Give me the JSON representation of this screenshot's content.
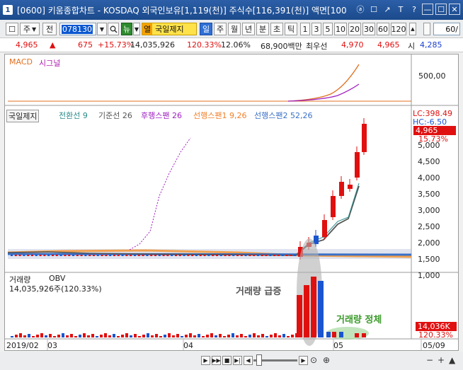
{
  "window": {
    "title": "[0600] 키움종합차트 - KOSDAQ 외국인보유[1,119(천)] 주식수[116,391(천)] 액면[100",
    "icon_label": "1",
    "controls": [
      "ⓐ",
      "☐",
      "↗",
      "T",
      "?",
      "—",
      "☐",
      "✕"
    ]
  },
  "toolbar": {
    "left_glyph": "☐",
    "mode_label": "주",
    "prev_label": "전",
    "code_value": "078130",
    "news_label": "뉴",
    "name_tag": "열",
    "stock_name": "국일제지",
    "periods": [
      "일",
      "주",
      "월",
      "년",
      "분",
      "초",
      "틱"
    ],
    "active_period": "일",
    "intervals": [
      "1",
      "3",
      "5",
      "10",
      "20",
      "30",
      "60",
      "120"
    ],
    "count_value": "60/"
  },
  "quote": {
    "price": "4,965",
    "change": "675",
    "change_pct": "+15.73%",
    "volume": "14,035,926",
    "volume_ratio": "120.33%",
    "turnover": "12.06%",
    "trade_value": "68,900백만",
    "ask_label": "최우선",
    "ask": "4,970",
    "bid": "4,965",
    "open_label": "시",
    "open": "4,285"
  },
  "macd_panel": {
    "title": "MACD",
    "signal": "시그널",
    "axis_label": "500,00"
  },
  "price_panel": {
    "name_tag": "국일제지",
    "indicators": [
      {
        "label": "전환선 9",
        "color": "#2a8a8a"
      },
      {
        "label": "기준선 26",
        "color": "#555555"
      },
      {
        "label": "후행스팬 26",
        "color": "#a020c0"
      },
      {
        "label": "선행스팬1 9,26",
        "color": "#f0802a"
      },
      {
        "label": "선행스팬2 52,26",
        "color": "#3a70c8"
      }
    ],
    "lc_label": "LC:398.49",
    "hc_label": "HC:-6.50",
    "price_badge": "4,965",
    "pct_badge": "15.73%",
    "y_ticks": [
      "5,000",
      "4,500",
      "4,000",
      "3,500",
      "3,000",
      "2,500",
      "2,000",
      "1,500",
      "1,000"
    ]
  },
  "volume_panel": {
    "title": "거래량",
    "obv_label": "OBV",
    "detail": "14,035,926주(120.33%)",
    "annot_surge": "거래량 급증",
    "annot_stagnant": "거래량 정체",
    "badge_vol": "14,036K",
    "badge_pct": "120.33%"
  },
  "date_axis": {
    "labels": [
      "2019/02",
      "03",
      "04",
      "05",
      "05/09"
    ]
  },
  "colors": {
    "up": "#e01010",
    "down": "#1a55d0",
    "annotation_green": "#3a9a2a"
  }
}
